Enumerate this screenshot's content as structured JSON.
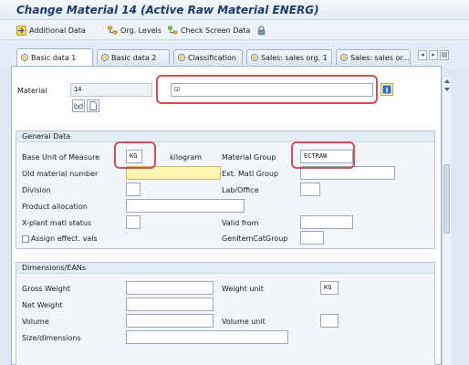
{
  "window": {
    "title": "Change Material 14 (Active Raw Material ENERG)"
  },
  "toolbar": {
    "items": [
      {
        "label": "Additional Data",
        "icon": "additional-data-icon"
      },
      {
        "label": "Org. Levels",
        "icon": "org-levels-icon"
      },
      {
        "label": "Check Screen Data",
        "icon": "check-screen-data-icon"
      }
    ],
    "lock_icon": "lock-icon"
  },
  "tabs": [
    {
      "label": "Basic data 1",
      "active": true
    },
    {
      "label": "Basic data 2",
      "active": false
    },
    {
      "label": "Classification",
      "active": false
    },
    {
      "label": "Sales: sales org. 1",
      "active": false
    },
    {
      "label": "Sales: sales or...",
      "active": false
    }
  ],
  "header": {
    "material_label": "Material",
    "material_value": "14",
    "description_value": "☑"
  },
  "general": {
    "title": "General Data",
    "base_uom_label": "Base Unit of Measure",
    "base_uom_value": "KG",
    "base_uom_text": "kilogram",
    "material_group_label": "Material Group",
    "material_group_value": "ECTRAW",
    "old_material_label": "Old material number",
    "ext_matl_group_label": "Ext. Matl Group",
    "division_label": "Division",
    "lab_office_label": "Lab/Office",
    "product_allocation_label": "Product allocation",
    "xplant_status_label": "X-plant matl status",
    "valid_from_label": "Valid from",
    "assign_effect_label": "Assign effect. vals",
    "gen_item_cat_label": "GenItemCatGroup"
  },
  "dimensions": {
    "title": "Dimensions/EANs",
    "gross_weight_label": "Gross Weight",
    "weight_unit_label": "Weight unit",
    "weight_unit_value": "KG",
    "net_weight_label": "Net Weight",
    "volume_label": "Volume",
    "volume_unit_label": "Volume unit",
    "size_dimensions_label": "Size/dimensions"
  },
  "colors": {
    "highlight": "#c9535a",
    "title_text": "#1d3b6a",
    "required_field": "#fff3b3"
  }
}
